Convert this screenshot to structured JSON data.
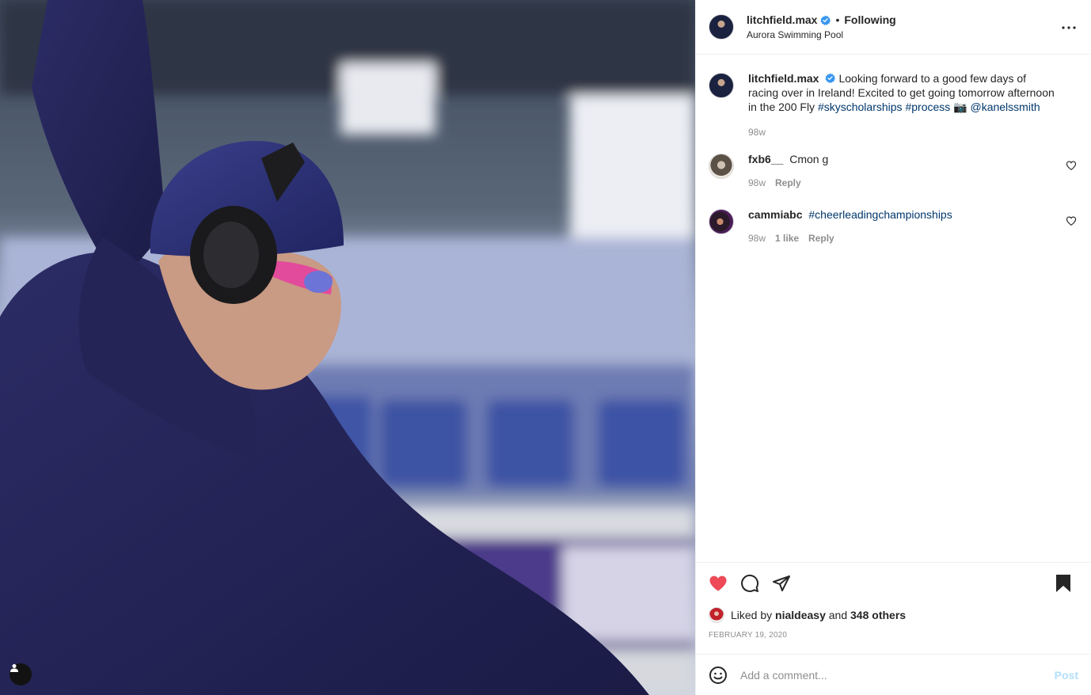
{
  "post": {
    "username": "litchfield.max",
    "follow_separator": "•",
    "follow_status": "Following",
    "location": "Aurora Swimming Pool",
    "more_icon": "more-horizontal-icon"
  },
  "caption": {
    "username": "litchfield.max",
    "text": "Looking forward to a good few days of racing over in Ireland! Excited to get going tomorrow afternoon in the 200 Fly",
    "hashtag_1": "#skyscholarships",
    "hashtag_2": "#process",
    "camera_emoji": "📷",
    "mention": "@kanelssmith",
    "age": "98w"
  },
  "comments": [
    {
      "username": "fxb6__",
      "text": "Cmon g",
      "age": "98w",
      "likes": "",
      "reply": "Reply"
    },
    {
      "username": "cammiabc",
      "text": "#cheerleadingchampionships",
      "age": "98w",
      "likes": "1 like",
      "reply": "Reply"
    }
  ],
  "liked_by": {
    "prefix": "Liked by",
    "user": "nialdeasy",
    "and": "and",
    "others": "348 others"
  },
  "date": "FEBRUARY 19, 2020",
  "add_comment": {
    "placeholder": "Add a comment...",
    "post_label": "Post"
  },
  "colors": {
    "like_red": "#ed4956",
    "link_blue": "#00376b",
    "verified_blue": "#3897f0",
    "post_disabled": "#b2dffc"
  }
}
